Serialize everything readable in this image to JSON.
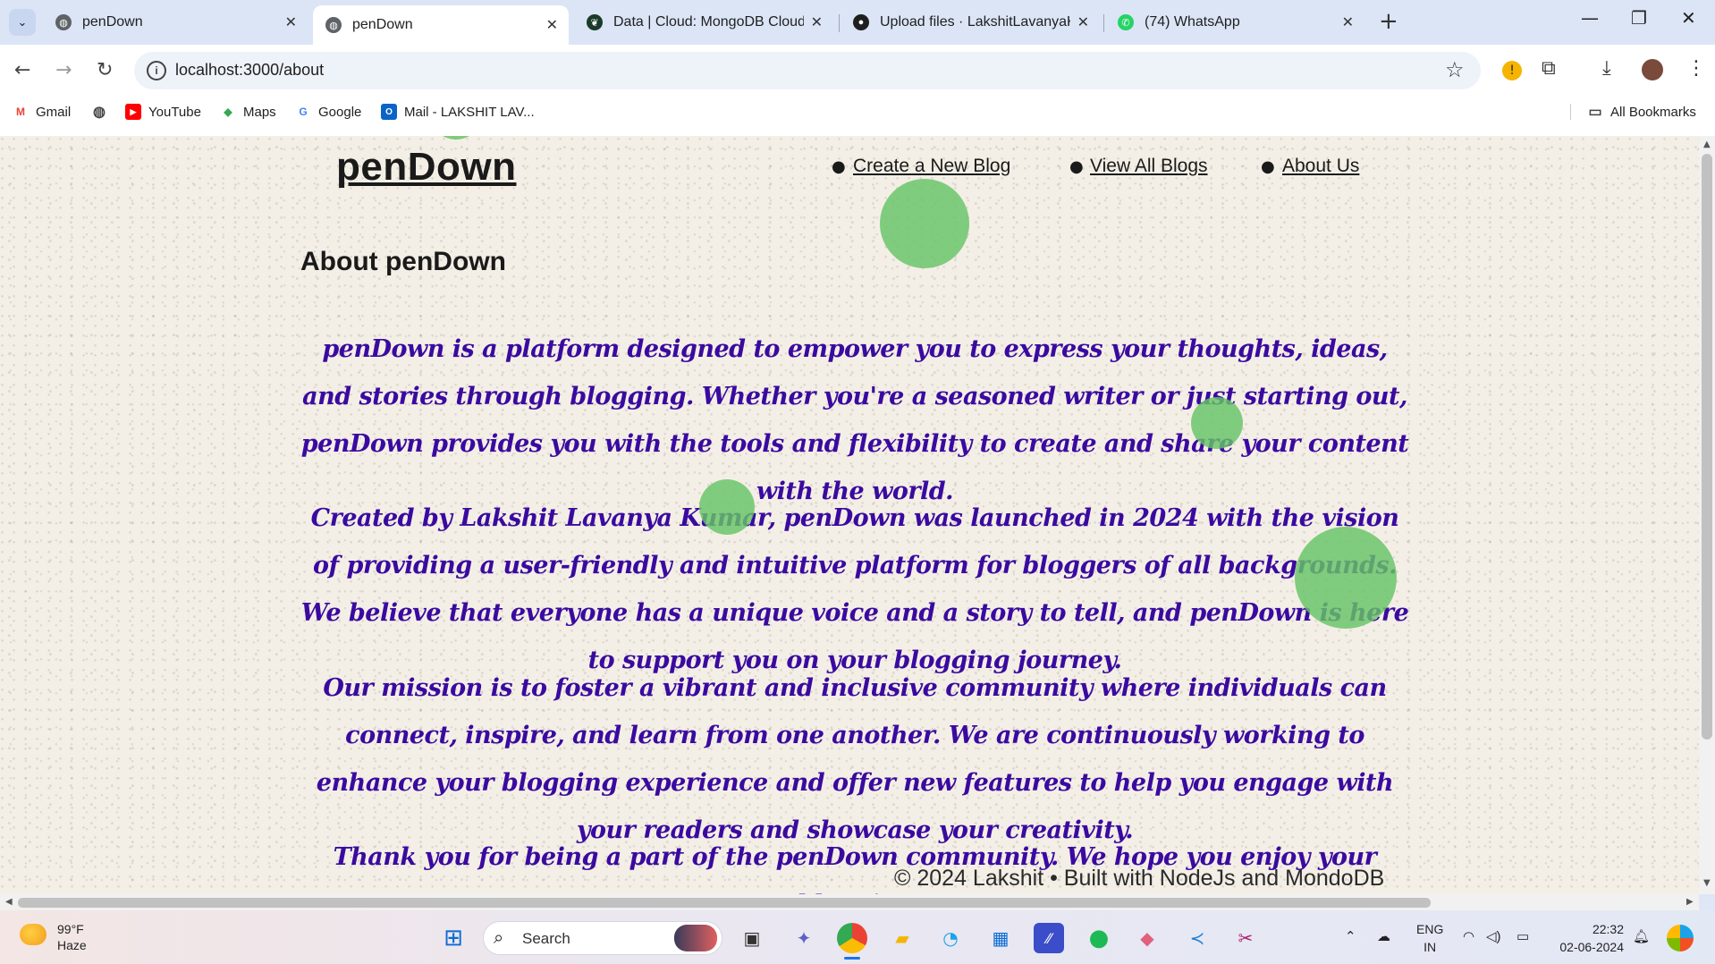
{
  "browser": {
    "tabs": [
      {
        "title": "penDown",
        "active": false
      },
      {
        "title": "penDown",
        "active": true
      },
      {
        "title": "Data | Cloud: MongoDB Cloud",
        "active": false
      },
      {
        "title": "Upload files · LakshitLavanyaKu",
        "active": false
      },
      {
        "title": "(74) WhatsApp",
        "active": false
      }
    ],
    "url": "localhost:3000/about",
    "bookmarks": [
      "Gmail",
      "YouTube",
      "Maps",
      "Google",
      "Mail - LAKSHIT LAV..."
    ],
    "all_bookmarks": "All Bookmarks"
  },
  "site": {
    "logo": "penDown",
    "nav": [
      "Create a New Blog",
      "View All Blogs",
      "About Us"
    ],
    "heading": "About penDown",
    "paragraphs": [
      "penDown is a platform designed to empower you to express your thoughts, ideas, and stories through blogging. Whether you're a seasoned writer or just starting out, penDown provides you with the tools and flexibility to create and share your content with the world.",
      "Created by Lakshit Lavanya Kumar, penDown was launched in 2024 with the vision of providing a user-friendly and intuitive platform for bloggers of all backgrounds. We believe that everyone has a unique voice and a story to tell, and penDown is here to support you on your blogging journey.",
      "Our mission is to foster a vibrant and inclusive community where individuals can connect, inspire, and learn from one another. We are continuously working to enhance your blogging experience and offer new features to help you engage with your readers and showcase your creativity.",
      "Thank you for being a part of the penDown community. We hope you enjoy your blogging"
    ],
    "footer": "© 2024 Lakshit • Built with NodeJs and MondoDB",
    "colors": {
      "text": "#3a0aa0",
      "bubble": "#66c466",
      "background": "#f4efe6"
    }
  },
  "taskbar": {
    "weather_temp": "99°F",
    "weather_desc": "Haze",
    "search_placeholder": "Search",
    "lang_line1": "ENG",
    "lang_line2": "IN",
    "time": "22:32",
    "date": "02-06-2024"
  }
}
